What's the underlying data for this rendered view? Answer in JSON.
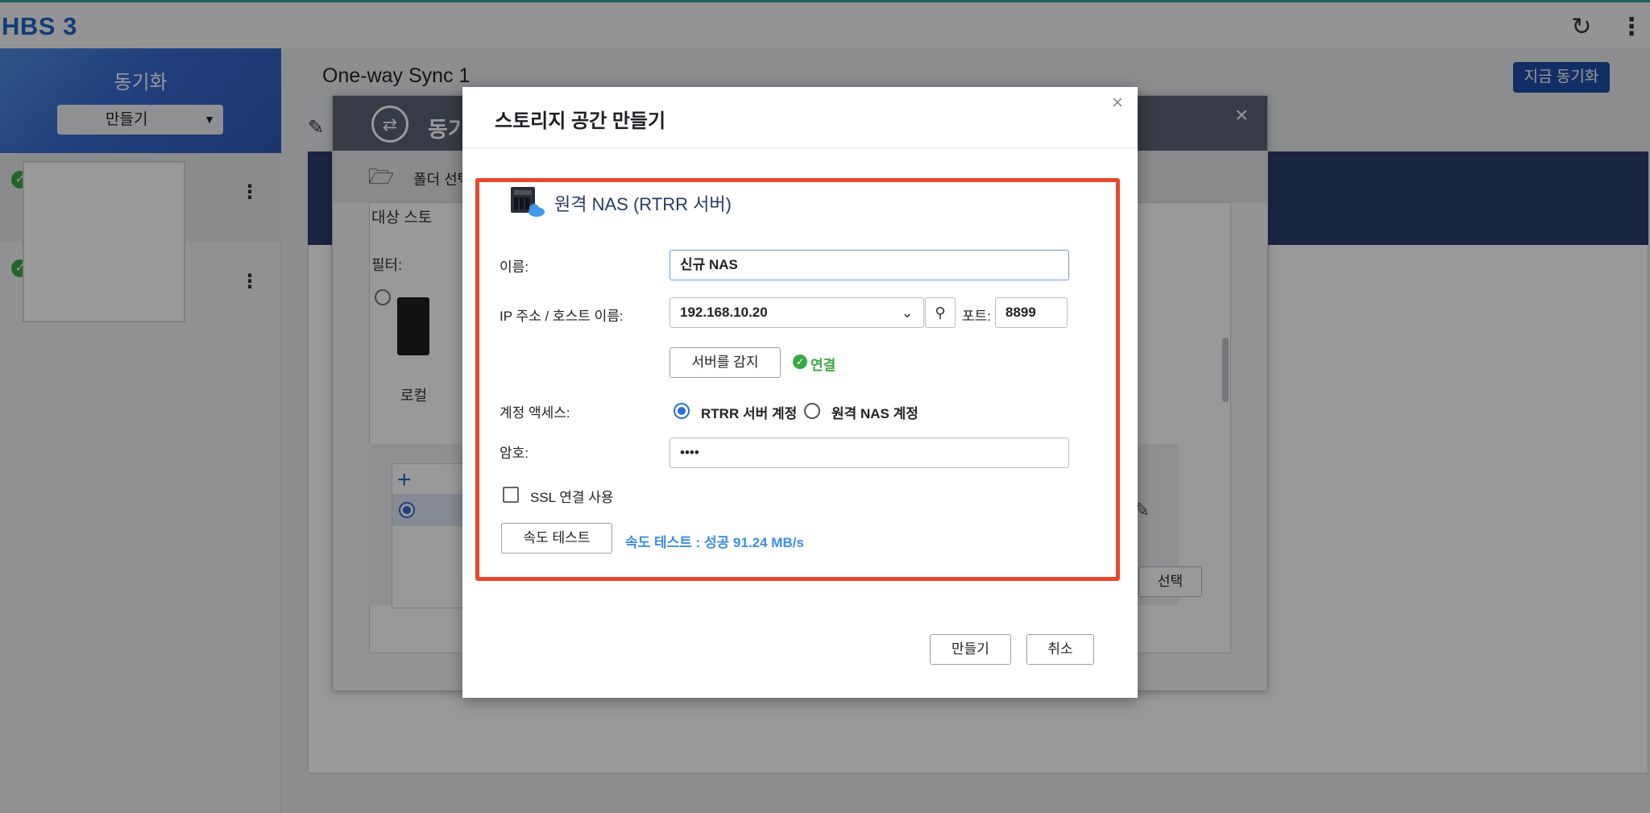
{
  "app": {
    "title": "HBS 3"
  },
  "sidebar": {
    "title": "동기화",
    "create_dropdown": "만들기"
  },
  "main": {
    "title": "One-way Sync 1",
    "sync_now": "지금 동기화"
  },
  "wizard": {
    "title": "동기",
    "tab_label": "폴더 선택",
    "target_label": "대상 스토",
    "filter_label": "필터:",
    "local_label": "로컬",
    "select_button": "선택"
  },
  "dialog": {
    "title": "스토리지 공간 만들기",
    "section_title": "원격 NAS (RTRR 서버)",
    "name_label": "이름:",
    "name_value": "신규 NAS",
    "ip_label": "IP 주소 / 호스트 이름:",
    "ip_value": "192.168.10.20",
    "port_label": "포트:",
    "port_value": "8899",
    "detect_button": "서버를 감지",
    "connection_status": "연결",
    "account_label": "계정 액세스:",
    "account_options": [
      "RTRR 서버 계정",
      "원격 NAS 계정"
    ],
    "account_selected": "RTRR 서버 계정",
    "password_label": "암호:",
    "password_value": "••••",
    "ssl_label": "SSL 연결 사용",
    "ssl_checked": false,
    "speed_test_button": "속도 테스트",
    "speed_test_result": "속도 테스트 : 성공 91.24 MB/s",
    "create_button": "만들기",
    "cancel_button": "취소"
  },
  "colors": {
    "accent": "#2167c7",
    "highlight": "#e8472b",
    "success": "#3aa845",
    "link": "#3b8ee8",
    "primary_button": "#1e4fa8"
  }
}
